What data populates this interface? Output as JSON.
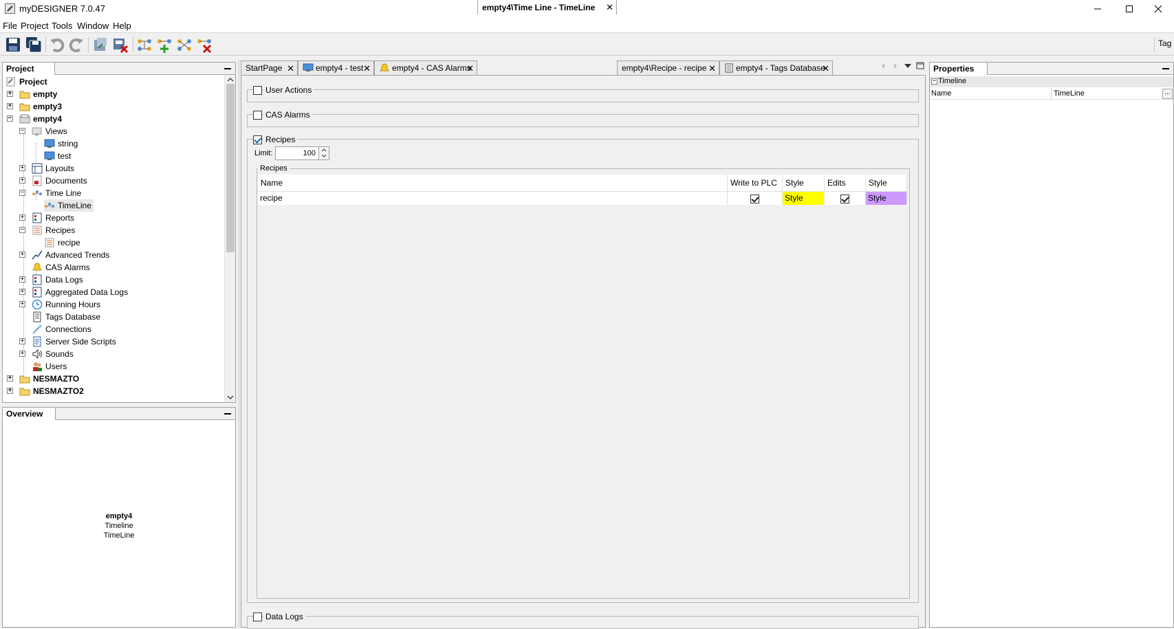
{
  "window": {
    "title": "myDESIGNER 7.0.47"
  },
  "menu": [
    "File",
    "Project",
    "Tools",
    "Window",
    "Help"
  ],
  "toolbar": {
    "right_label": "Tag"
  },
  "project_panel": {
    "title": "Project",
    "root": "Project",
    "items": [
      {
        "label": "empty"
      },
      {
        "label": "empty3"
      },
      {
        "label": "empty4"
      },
      {
        "label": "Views"
      },
      {
        "label": "string"
      },
      {
        "label": "test"
      },
      {
        "label": "Layouts"
      },
      {
        "label": "Documents"
      },
      {
        "label": "Time Line"
      },
      {
        "label": "TimeLine"
      },
      {
        "label": "Reports"
      },
      {
        "label": "Recipes"
      },
      {
        "label": "recipe"
      },
      {
        "label": "Advanced Trends"
      },
      {
        "label": "CAS Alarms"
      },
      {
        "label": "Data Logs"
      },
      {
        "label": "Aggregated Data Logs"
      },
      {
        "label": "Running Hours"
      },
      {
        "label": "Tags Database"
      },
      {
        "label": "Connections"
      },
      {
        "label": "Server Side Scripts"
      },
      {
        "label": "Sounds"
      },
      {
        "label": "Users"
      },
      {
        "label": "NESMAZTO"
      },
      {
        "label": "NESMAZTO2"
      }
    ]
  },
  "overview_panel": {
    "title": "Overview",
    "line1": "empty4",
    "line2": "Timeline",
    "line3": "TimeLine"
  },
  "tabs": [
    {
      "label": "StartPage"
    },
    {
      "label": "empty4 - test"
    },
    {
      "label": "empty4 - CAS Alarms"
    },
    {
      "label": "empty4\\Time Line - TimeLine"
    },
    {
      "label": "empty4\\Recipe - recipe"
    },
    {
      "label": "empty4 - Tags Database"
    }
  ],
  "editor": {
    "user_actions": "User Actions",
    "cas_alarms": "CAS Alarms",
    "recipes": "Recipes",
    "limit_label": "Limit:",
    "limit_value": "100",
    "recipes_group": "Recipes",
    "columns": [
      "Name",
      "Write to PLC",
      "Style",
      "Edits",
      "Style"
    ],
    "rows": [
      {
        "name": "recipe",
        "write_to_plc": true,
        "style1": "Style",
        "edits": true,
        "style2": "Style"
      }
    ],
    "data_logs": "Data Logs",
    "style1_color": "#ffff00",
    "style2_color": "#cc99ff"
  },
  "properties_panel": {
    "title": "Properties",
    "category": "Timeline",
    "prop_name": "Name",
    "prop_value": "TimeLine",
    "ellipsis": "..."
  }
}
